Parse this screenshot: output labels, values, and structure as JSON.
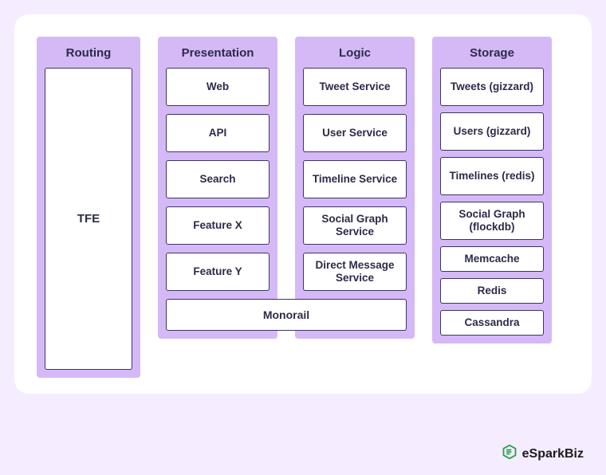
{
  "columns": {
    "routing": {
      "header": "Routing",
      "items": [
        "TFE"
      ]
    },
    "presentation": {
      "header": "Presentation",
      "items": [
        "Web",
        "API",
        "Search",
        "Feature X",
        "Feature Y"
      ]
    },
    "logic": {
      "header": "Logic",
      "items": [
        "Tweet Service",
        "User Service",
        "Timeline Service",
        "Social Graph Service",
        "Direct Message Service"
      ]
    },
    "storage": {
      "header": "Storage",
      "group1": [
        "Tweets (gizzard)",
        "Users (gizzard)",
        "Timelines (redis)",
        "Social Graph (flockdb)"
      ],
      "group2": [
        "Memcache",
        "Redis",
        "Cassandra"
      ]
    }
  },
  "spanning": {
    "monorail": "Monorail"
  },
  "branding": {
    "name": "eSparkBiz",
    "accent": "#2aa24a"
  }
}
